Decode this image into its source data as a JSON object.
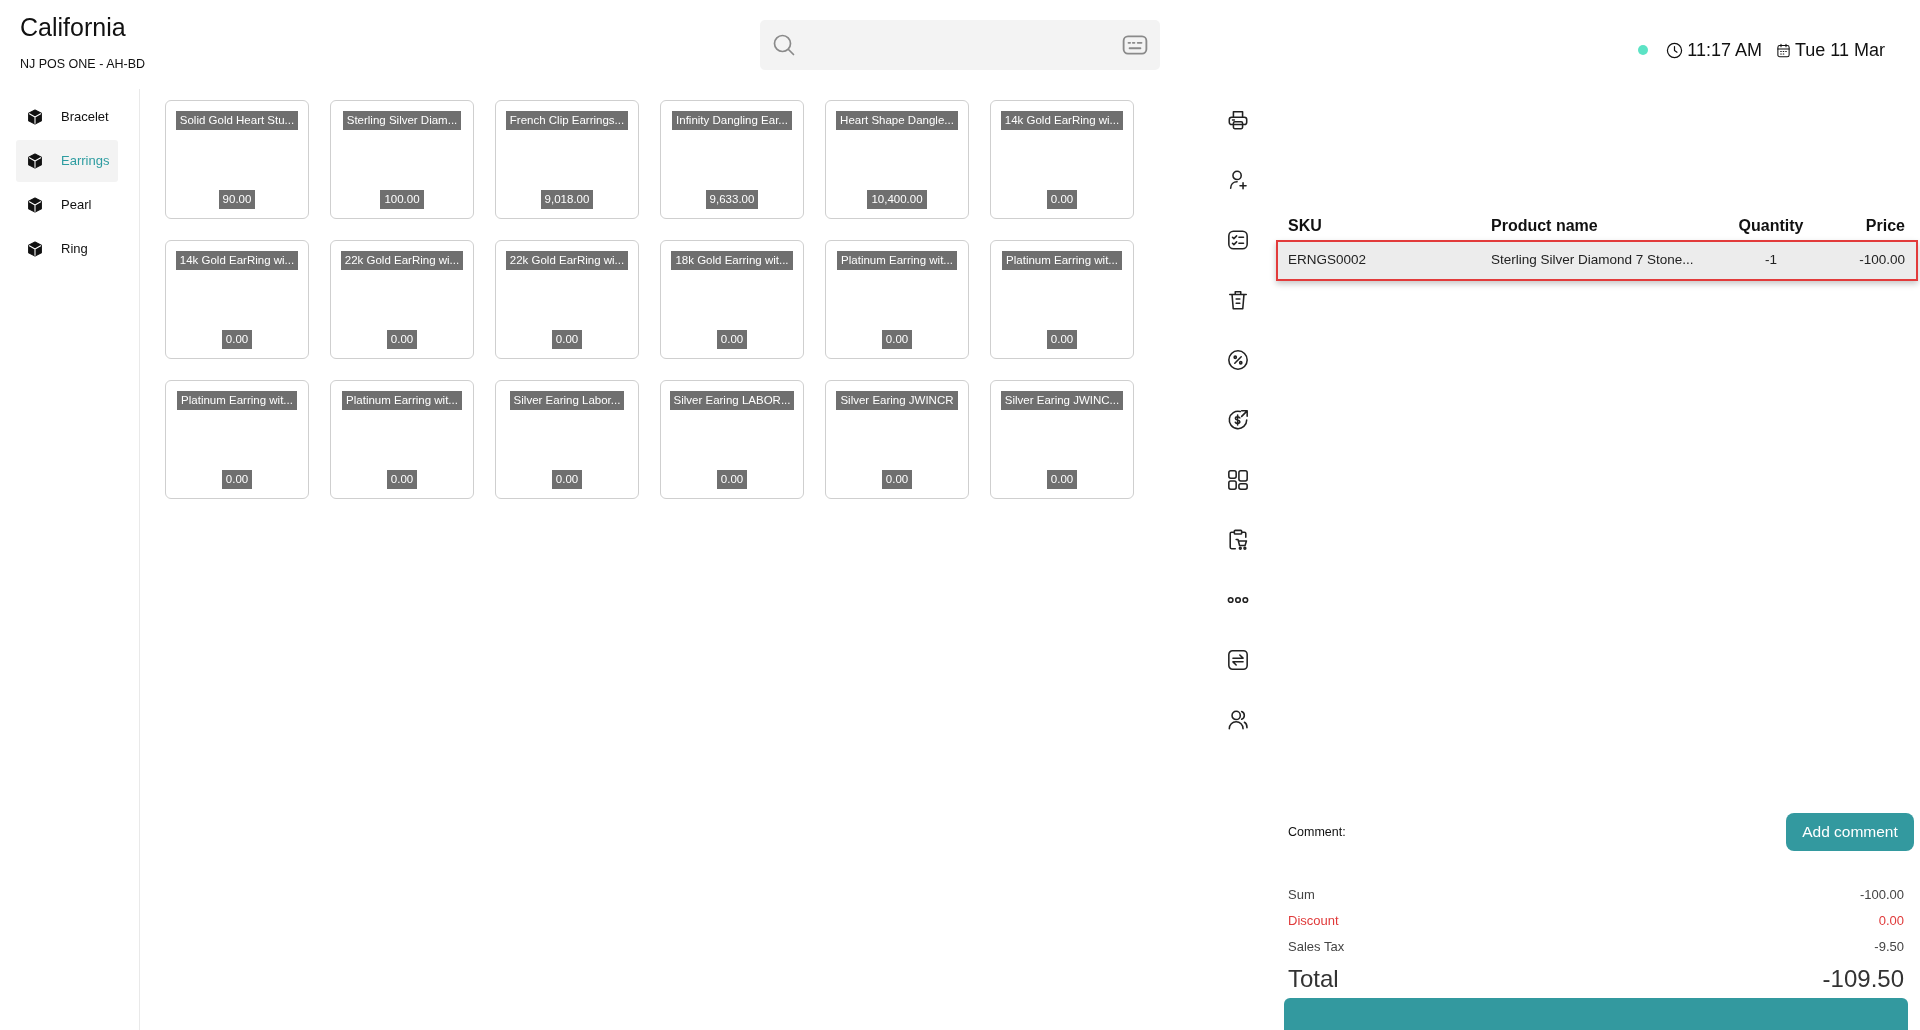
{
  "header": {
    "store_name": "California",
    "register": "NJ POS ONE - AH-BD"
  },
  "status": {
    "connected": true,
    "time": "11:17 AM",
    "date": "Tue 11 Mar"
  },
  "categories": [
    {
      "label": "Bracelet",
      "selected": false
    },
    {
      "label": "Earrings",
      "selected": true
    },
    {
      "label": "Pearl",
      "selected": false
    },
    {
      "label": "Ring",
      "selected": false
    }
  ],
  "products": [
    {
      "name": "Solid Gold Heart Stu...",
      "price": "90.00"
    },
    {
      "name": "Sterling Silver Diam...",
      "price": "100.00"
    },
    {
      "name": "French Clip Earrings...",
      "price": "9,018.00"
    },
    {
      "name": "Infinity Dangling Ear...",
      "price": "9,633.00"
    },
    {
      "name": "Heart Shape Dangle...",
      "price": "10,400.00"
    },
    {
      "name": "14k Gold EarRing wi...",
      "price": "0.00"
    },
    {
      "name": "14k Gold EarRing wi...",
      "price": "0.00"
    },
    {
      "name": "22k Gold EarRing wi...",
      "price": "0.00"
    },
    {
      "name": "22k Gold EarRing wi...",
      "price": "0.00"
    },
    {
      "name": "18k Gold Earring wit...",
      "price": "0.00"
    },
    {
      "name": "Platinum Earring wit...",
      "price": "0.00"
    },
    {
      "name": "Platinum Earring wit...",
      "price": "0.00"
    },
    {
      "name": "Platinum Earring wit...",
      "price": "0.00"
    },
    {
      "name": "Platinum Earring wit...",
      "price": "0.00"
    },
    {
      "name": "Silver Earing Labor...",
      "price": "0.00"
    },
    {
      "name": "Silver Earing LABOR...",
      "price": "0.00"
    },
    {
      "name": "Silver Earing JWINCR",
      "price": "0.00"
    },
    {
      "name": "Silver Earing JWINC...",
      "price": "0.00"
    }
  ],
  "cart": {
    "columns": [
      "SKU",
      "Product name",
      "Quantity",
      "Price"
    ],
    "rows": [
      {
        "sku": "ERNGS0002",
        "product_name": "Sterling Silver Diamond 7 Stone...",
        "quantity": "-1",
        "price": "-100.00",
        "selected": true
      }
    ]
  },
  "comment": {
    "label": "Comment:",
    "button": "Add comment"
  },
  "summary": [
    {
      "label": "Sum",
      "value": "-100.00",
      "kind": "normal"
    },
    {
      "label": "Discount",
      "value": "0.00",
      "kind": "discount"
    },
    {
      "label": "Sales Tax",
      "value": "-9.50",
      "kind": "normal"
    }
  ],
  "total": {
    "label": "Total",
    "value": "-109.50"
  }
}
